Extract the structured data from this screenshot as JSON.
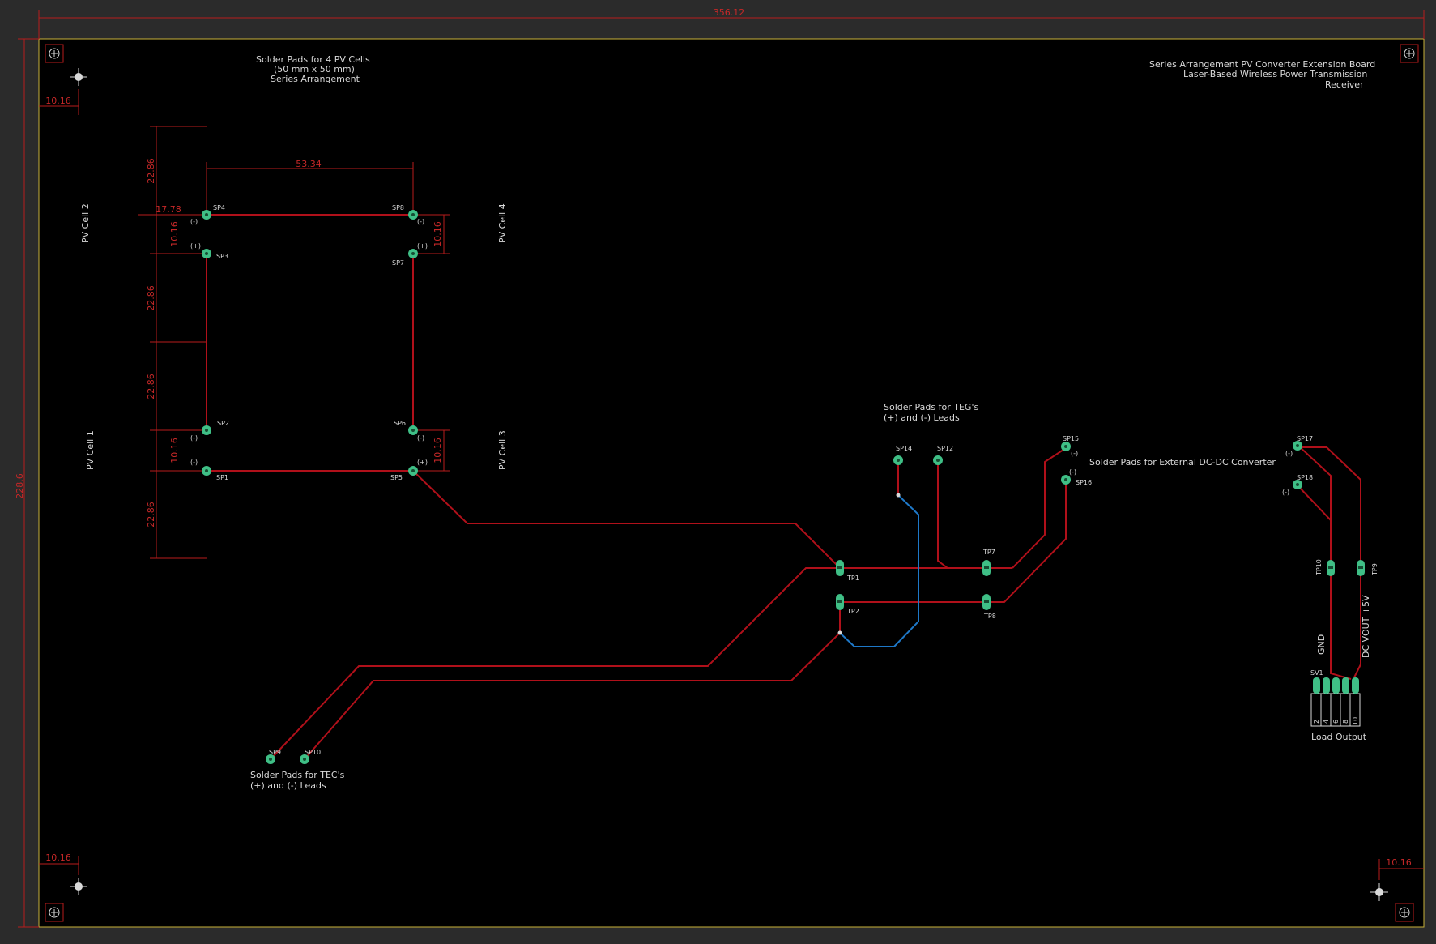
{
  "board": {
    "width_dim": "356.12",
    "height_dim": "228.6",
    "corner_dims": [
      "10.16",
      "10.16",
      "10.16"
    ],
    "colors": {
      "background": "#000000",
      "frame": "#2b2b2b",
      "outline": "#c9b23a",
      "trace_top": "#b0101a",
      "trace_bottom": "#1e78c8",
      "pad": "#3fbf86",
      "dimension": "#c62828",
      "text": "#d9d9d9"
    }
  },
  "title_block": {
    "line1": "Series Arrangement PV Converter Extension Board",
    "line2": "Laser-Based Wireless Power Transmission",
    "line3": "Receiver"
  },
  "pv_section": {
    "title": [
      "Solder Pads for 4 PV Cells",
      "(50 mm x 50 mm)",
      "Series Arrangement"
    ],
    "cells": [
      "PV Cell 2",
      "PV Cell 4",
      "PV Cell 1",
      "PV Cell 3"
    ],
    "dims": {
      "top_h": "22.86",
      "width": "53.34",
      "left": "17.78",
      "pad_gap_l1": "10.16",
      "pad_gap_r1": "10.16",
      "mid_h1": "22.86",
      "mid_h2": "22.86",
      "pad_gap_l2": "10.16",
      "pad_gap_r2": "10.16",
      "bot_h": "22.86"
    }
  },
  "pads": {
    "sp1": "SP1",
    "sp2": "SP2",
    "sp3": "SP3",
    "sp4": "SP4",
    "sp5": "SP5",
    "sp6": "SP6",
    "sp7": "SP7",
    "sp8": "SP8",
    "sp9": "SP9",
    "sp10": "SP10",
    "sp14": "SP14",
    "sp12": "SP12",
    "sp15": "SP15",
    "sp16": "SP16",
    "sp17": "SP17",
    "sp18": "SP18",
    "tp1": "TP1",
    "tp2": "TP2",
    "tp7": "TP7",
    "tp8": "TP8",
    "tp9": "TP9",
    "tp10": "TP10",
    "sv1": "SV1"
  },
  "polarity": {
    "neg": "(-)",
    "pos": "(+)"
  },
  "teg": {
    "line1": "Solder Pads for TEG's",
    "line2": "(+) and (-) Leads"
  },
  "tec": {
    "line1": "Solder Pads for TEC's",
    "line2": "(+) and (-) Leads"
  },
  "dcdc": {
    "label": "Solder Pads for External DC-DC Converter"
  },
  "load": {
    "gnd": "GND",
    "vout": "DC VOUT +5V",
    "label": "Load Output",
    "pins": [
      "2",
      "4",
      "6",
      "8",
      "10"
    ]
  }
}
